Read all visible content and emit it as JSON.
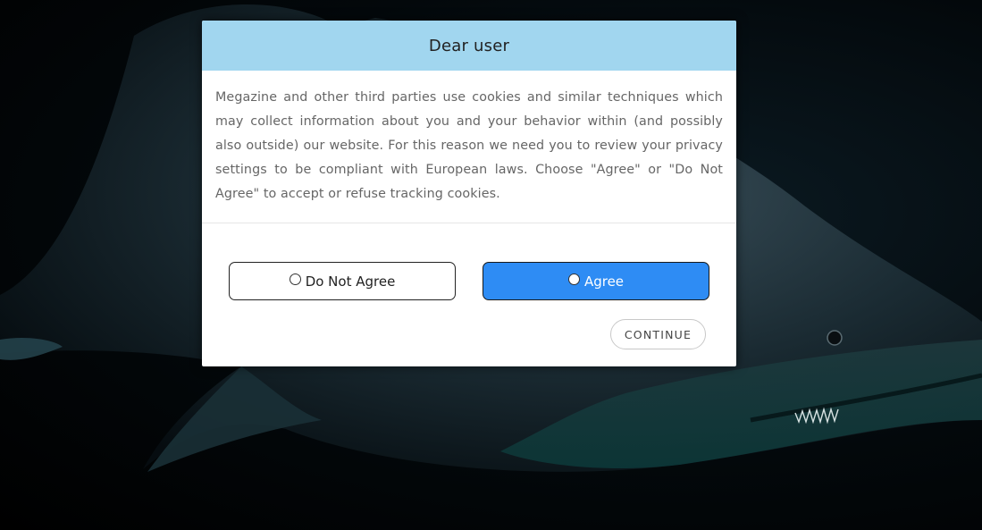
{
  "dialog": {
    "title": "Dear user",
    "message": "Megazine and other third parties use cookies and similar techniques which may collect information about you and your behavior within (and possibly also outside) our website. For this reason we need you to review your privacy settings to be compliant with European laws. Choose \"Agree\" or \"Do Not Agree\" to accept or refuse tracking cookies.",
    "options": {
      "disagree_label": "Do Not Agree",
      "agree_label": "Agree",
      "selected": "Agree"
    },
    "continue_label": "CONTINUE"
  },
  "colors": {
    "header_background": "#a1d6ef",
    "agree_button": "#2e8cf4",
    "page_background": "#000000"
  }
}
